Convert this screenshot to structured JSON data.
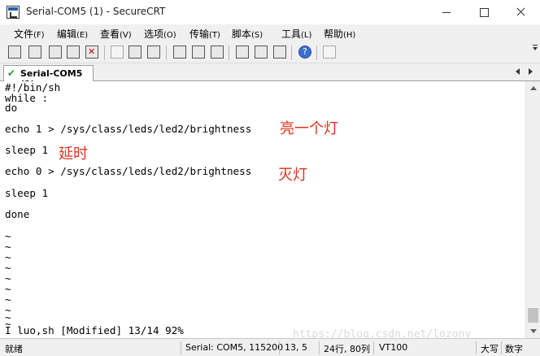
{
  "window": {
    "title": "Serial-COM5 (1) - SecureCRT"
  },
  "menu": [
    {
      "label": "文件",
      "accel": "(F)"
    },
    {
      "label": "编辑",
      "accel": "(E)"
    },
    {
      "label": "查看",
      "accel": "(V)"
    },
    {
      "label": "选项",
      "accel": "(O)"
    },
    {
      "label": "传输",
      "accel": "(T)"
    },
    {
      "label": "脚本",
      "accel": "(S)"
    },
    {
      "label": "工具",
      "accel": "(L)"
    },
    {
      "label": "帮助",
      "accel": "(H)"
    }
  ],
  "toolbar": {
    "icons": [
      "connect-icon",
      "quick-connect-icon",
      "connect-in-tab-icon",
      "reconnect-icon",
      "disconnect-icon",
      "copy-icon",
      "paste-icon",
      "find-icon",
      "print-icon",
      "print-screen-icon",
      "print-setup-icon",
      "session-options-icon",
      "global-options-icon",
      "key-icon",
      "help-icon",
      "script-icon"
    ]
  },
  "tab": {
    "label": "Serial-COM5 (1)"
  },
  "terminal": {
    "lines": [
      "#!/bin/sh",
      "while :",
      "do",
      "echo 1 > /sys/class/leds/led2/brightness",
      "sleep 1",
      "echo 0 > /sys/class/leds/led2/brightness",
      "sleep 1",
      "done",
      "~",
      "~",
      "~",
      "~",
      "~",
      "~",
      "~",
      "~",
      "~",
      "~",
      "I luo,sh [Modified] 13/14 92%"
    ],
    "annotations": [
      "亮一个灯",
      "延时",
      "灭灯"
    ]
  },
  "watermark": "https://blog.csdn.net/lozony",
  "status": {
    "ready": "就绪",
    "connection": "Serial: COM5, 115200",
    "position": "13,  5",
    "size": "24行, 80列",
    "terminal_type": "VT100",
    "caps": "大写",
    "num": "数字"
  },
  "colors": {
    "annotation": "#e0311c",
    "tab_check": "#2a9d2a"
  }
}
